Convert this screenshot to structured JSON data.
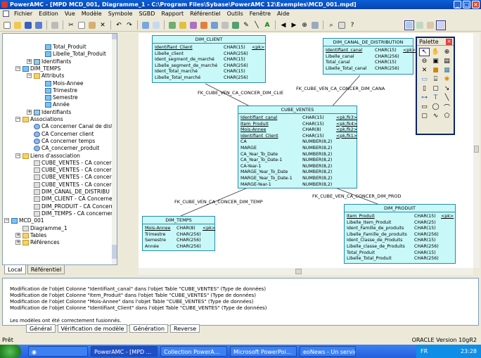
{
  "window": {
    "title": "PowerAMC - [MPD MCD_001, Diagramme_1 - C:\\Program Files\\Sybase\\PowerAMC 12\\Exemples\\MCD_001.mpd]"
  },
  "menu": [
    "Fichier",
    "Edition",
    "Vue",
    "Modèle",
    "Symbole",
    "SGBD",
    "Rapport",
    "Référentiel",
    "Outils",
    "Fenêtre",
    "Aide"
  ],
  "tree": {
    "items": [
      {
        "label": "Total_Produit",
        "type": "tbl"
      },
      {
        "label": "Libelle_Total_Produit",
        "type": "tbl"
      },
      {
        "label": "Identifiants",
        "type": "id"
      },
      {
        "label": "DIM_TEMPS",
        "type": "tbl"
      },
      {
        "label": "Attributs",
        "type": "fold"
      },
      {
        "label": "Mois-Annee",
        "type": "tbl"
      },
      {
        "label": "Trimestre",
        "type": "tbl"
      },
      {
        "label": "Semestre",
        "type": "tbl"
      },
      {
        "label": "Année",
        "type": "tbl"
      },
      {
        "label": "Identifiants",
        "type": "id"
      },
      {
        "label": "Associations",
        "type": "fold"
      },
      {
        "label": "CA concerner Canal de distrib",
        "type": "assoc"
      },
      {
        "label": "CA Concerner client",
        "type": "assoc"
      },
      {
        "label": "CA concerner temps",
        "type": "assoc"
      },
      {
        "label": "CA_concerner_produit",
        "type": "assoc"
      },
      {
        "label": "Liens d'association",
        "type": "fold"
      },
      {
        "label": "CUBE_VENTES - CA concern",
        "type": "ref"
      },
      {
        "label": "CUBE_VENTES - CA concern",
        "type": "ref"
      },
      {
        "label": "CUBE_VENTES - CA concern",
        "type": "ref"
      },
      {
        "label": "CUBE_VENTES - CA concern",
        "type": "ref"
      },
      {
        "label": "DIM_CANAL_DE_DISTRIBU",
        "type": "ref"
      },
      {
        "label": "DIM_CLIENT - CA Concerner",
        "type": "ref"
      },
      {
        "label": "DIM_PRODUIT - CA Concern",
        "type": "ref"
      },
      {
        "label": "DIM_TEMPS - CA concerner",
        "type": "ref"
      },
      {
        "label": "MCD_001",
        "type": "tbl"
      },
      {
        "label": "Diagramme_1",
        "type": "ref"
      },
      {
        "label": "Tables",
        "type": "fold"
      },
      {
        "label": "Références",
        "type": "fold"
      }
    ]
  },
  "left_tabs": [
    "Local",
    "Référentiel"
  ],
  "entities": {
    "dim_client": {
      "name": "DIM_CLIENT",
      "rows": [
        {
          "n": "Identifiant_Client",
          "t": "CHAR(15)",
          "k": "<pk>"
        },
        {
          "n": "Libelle_client",
          "t": "CHAR(256)",
          "k": ""
        },
        {
          "n": "Ident_segment_de_marché",
          "t": "CHAR(15)",
          "k": ""
        },
        {
          "n": "Libelle_segment_de_marché",
          "t": "CHAR(256)",
          "k": ""
        },
        {
          "n": "Ident_Total_marché",
          "t": "CHAR(15)",
          "k": ""
        },
        {
          "n": "Libelle_Total_marché",
          "t": "CHAR(256)",
          "k": ""
        }
      ]
    },
    "dim_canal": {
      "name": "DIM_CANAL_DE_DISTRIBUTION",
      "rows": [
        {
          "n": "Identifiant_canal",
          "t": "CHAR(15)",
          "k": "<pk>"
        },
        {
          "n": "Libelle_canal",
          "t": "CHAR(256)",
          "k": ""
        },
        {
          "n": "Total_canal",
          "t": "CHAR(15)",
          "k": ""
        },
        {
          "n": "Libelle_Total_canal",
          "t": "CHAR(256)",
          "k": ""
        }
      ]
    },
    "cube_ventes": {
      "name": "CUBE_VENTES",
      "rows": [
        {
          "n": "Identifiant_canal",
          "t": "CHAR(15)",
          "k": "<pk,fk3>"
        },
        {
          "n": "Item_Produit",
          "t": "CHAR(15)",
          "k": "<pk,fk4>"
        },
        {
          "n": "Mois-Annee",
          "t": "CHAR(8)",
          "k": "<pk,fk2>"
        },
        {
          "n": "Identifiant_Client",
          "t": "CHAR(15)",
          "k": "<pk,fk1>"
        },
        {
          "n": "CA",
          "t": "NUMBER(8,2)",
          "k": ""
        },
        {
          "n": "MARGE",
          "t": "NUMBER(8,2)",
          "k": ""
        },
        {
          "n": "CA_Year_To_Date",
          "t": "NUMBER(8,2)",
          "k": ""
        },
        {
          "n": "CA_Year_To_Date-1",
          "t": "NUMBER(8,2)",
          "k": ""
        },
        {
          "n": "CA-Year-1",
          "t": "NUMBER(8,2)",
          "k": ""
        },
        {
          "n": "MARGE_Year_To_Date",
          "t": "NUMBER(8,2)",
          "k": ""
        },
        {
          "n": "MARGE_Year_To_Date-1",
          "t": "NUMBER(8,2)",
          "k": ""
        },
        {
          "n": "MARGE-Year-1",
          "t": "NUMBER(8,2)",
          "k": ""
        }
      ]
    },
    "dim_temps": {
      "name": "DIM_TEMPS",
      "rows": [
        {
          "n": "Mois-Annee",
          "t": "CHAR(8)",
          "k": "<pk>"
        },
        {
          "n": "Trimestre",
          "t": "CHAR(256)",
          "k": ""
        },
        {
          "n": "Semestre",
          "t": "CHAR(256)",
          "k": ""
        },
        {
          "n": "Année",
          "t": "CHAR(256)",
          "k": ""
        }
      ]
    },
    "dim_produit": {
      "name": "DIM_PRODUIT",
      "rows": [
        {
          "n": "Item_Produit",
          "t": "CHAR(15)",
          "k": "<pk>"
        },
        {
          "n": "Libelle_Item_Produit",
          "t": "CHAR(25)",
          "k": ""
        },
        {
          "n": "Ident_Famille_de_produits",
          "t": "CHAR(15)",
          "k": ""
        },
        {
          "n": "Libelle_Famille_de_produits",
          "t": "CHAR(256)",
          "k": ""
        },
        {
          "n": "Ident_Classe_de_Produits",
          "t": "CHAR(15)",
          "k": ""
        },
        {
          "n": "Libelle_classe_de_Produits",
          "t": "CHAR(256)",
          "k": ""
        },
        {
          "n": "Total_Produit",
          "t": "CHAR(15)",
          "k": ""
        },
        {
          "n": "Libelle_Total_Produit",
          "t": "CHAR(256)",
          "k": ""
        }
      ]
    }
  },
  "relations": {
    "clie": "FK_CUBE_VEN_CA_CONCER_DIM_CLIE",
    "cana": "FK_CUBE_VEN_CA_CONCER_DIM_CANA",
    "temp": "FK_CUBE_VEN_CA_CONCER_DIM_TEMP",
    "prod": "FK_CUBE_VEN_CA_CONCER_DIM_PROD"
  },
  "palette": {
    "title": "Palette"
  },
  "output": {
    "lines": [
      "Modification de l'objet Colonne \"Identifiant_canal\" dans l'objet Table \"CUBE_VENTES\" (Type de données)",
      "Modification de l'objet Colonne \"Item_Produit\" dans l'objet Table \"CUBE_VENTES\" (Type de données)",
      "Modification de l'objet Colonne \"Mois-Annee\" dans l'objet Table \"CUBE_VENTES\" (Type de données)",
      "Modification de l'objet Colonne \"Identifiant_Client\" dans l'objet Table \"CUBE_VENTES\" (Type de données)",
      "",
      "Les modèles ont été correctement fusionnés."
    ],
    "tabs": [
      "Général",
      "Vérification de modèle",
      "Génération",
      "Reverse"
    ]
  },
  "status": {
    "left": "Prêt",
    "right": "ORACLE Version 10gR2"
  },
  "taskbar": {
    "items": [
      "PowerAMC - [MPD ...",
      "Collection PowerA...",
      "Microsoft PowerPoi...",
      "eoNews - Un service..."
    ],
    "lang": "FR",
    "time": "23:28"
  }
}
